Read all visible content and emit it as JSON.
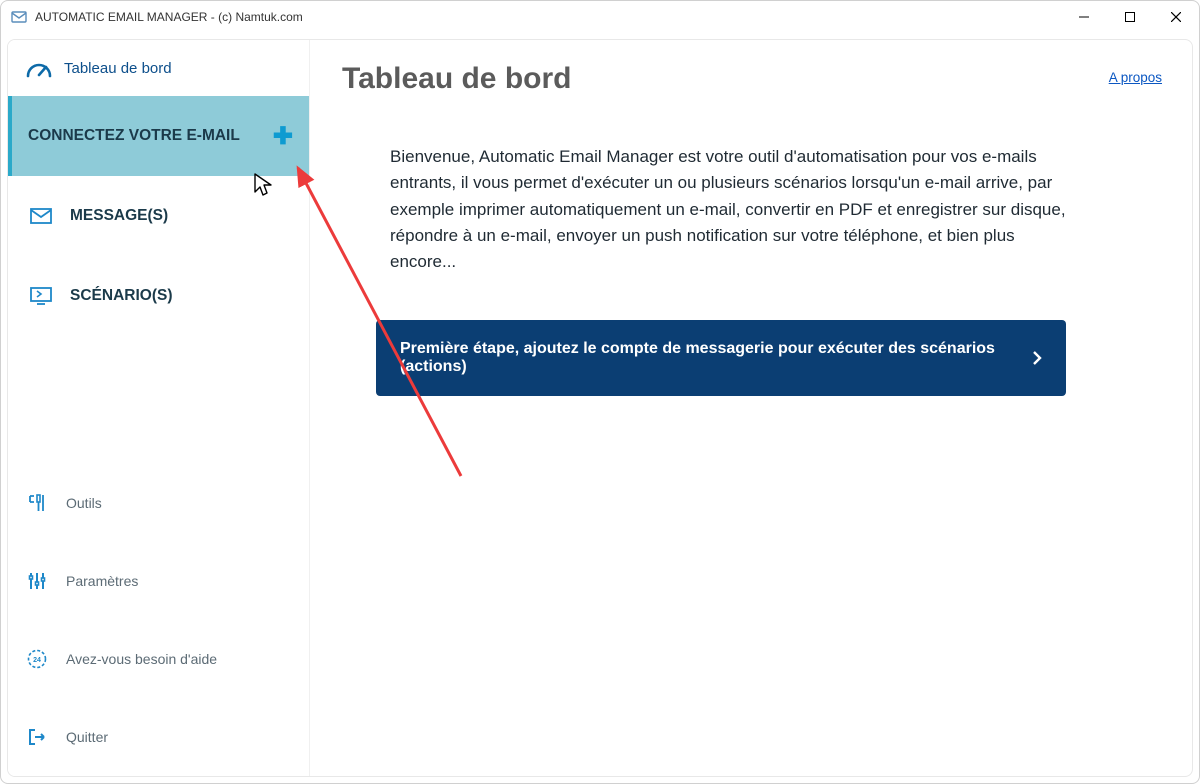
{
  "window": {
    "title": "AUTOMATIC EMAIL MANAGER - (c) Namtuk.com"
  },
  "sidebar": {
    "dashboard_label": "Tableau de bord",
    "connect_label": "CONNECTEZ VOTRE E-MAIL",
    "messages_label": "MESSAGE(S)",
    "scenarios_label": "SCÉNARIO(S)",
    "tools_label": "Outils",
    "settings_label": "Paramètres",
    "help_label": "Avez-vous besoin d'aide",
    "quit_label": "Quitter"
  },
  "content": {
    "title": "Tableau de bord",
    "about_label": "A propos",
    "welcome_text": "Bienvenue, Automatic Email Manager est votre outil d'automatisation pour vos e-mails entrants, il vous permet d'exécuter un ou plusieurs scénarios lorsqu'un e-mail arrive, par exemple imprimer automatiquement un e-mail, convertir en PDF et enregistrer sur disque, répondre à un e-mail, envoyer un push notification sur votre téléphone, et bien plus encore...",
    "cta_label": "Première étape, ajoutez le compte de messagerie pour exécuter des scénarios (actions)"
  }
}
